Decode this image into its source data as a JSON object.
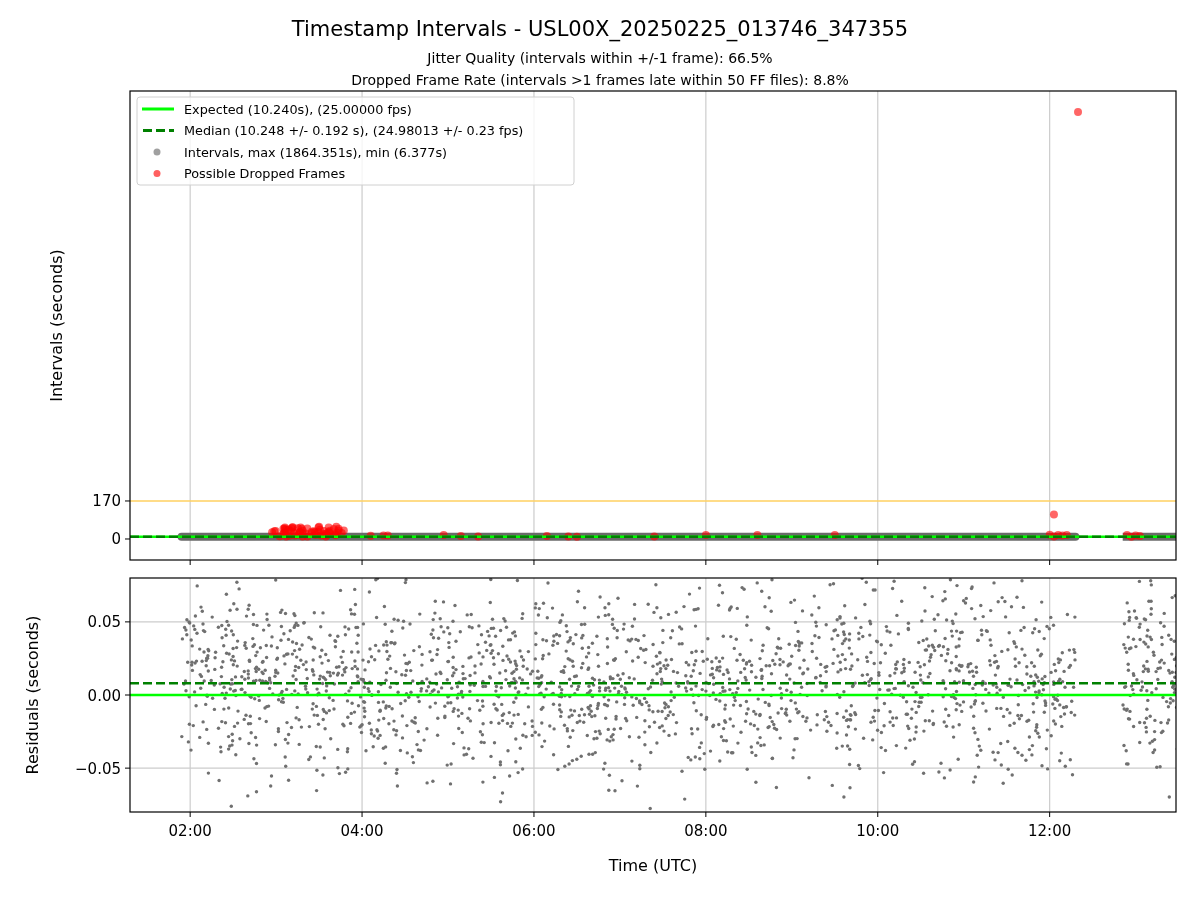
{
  "figure": {
    "title": "Timestamp Intervals - USL00X_20250225_013746_347355",
    "subtitles": [
      "Jitter Quality (intervals within +/-1 frame): 66.5%",
      "Dropped Frame Rate (intervals >1 frames late within 50 FF files): 8.8%"
    ]
  },
  "legend": [
    {
      "label": "Expected (10.240s), (25.00000 fps)",
      "kind": "line",
      "color": "#00ff00"
    },
    {
      "label": "Median (10.248 +/- 0.192 s), (24.98013 +/- 0.23 fps)",
      "kind": "dashed",
      "color": "#008000"
    },
    {
      "label": "Intervals, max (1864.351s), min (6.377s)",
      "kind": "marker",
      "color": "#a0a0a0"
    },
    {
      "label": "Possible Dropped Frames",
      "kind": "marker",
      "color": "#ff6060"
    }
  ],
  "intervals_chart": {
    "chart_data": {
      "type": "scatter",
      "ylabel": "Intervals (seconds)",
      "xlim": [
        1.3,
        13.47
      ],
      "ylim": [
        -94,
        2004
      ],
      "yticks": [
        {
          "value": 170,
          "label": "170"
        },
        {
          "value": 0,
          "label": "0"
        }
      ],
      "grid": true,
      "ref_lines": [
        {
          "axis": "y",
          "value": 170,
          "color": "#ffd060"
        },
        {
          "axis": "y",
          "value": 10.24,
          "color": "#00ff00"
        },
        {
          "axis": "y",
          "value": 10.248,
          "color": "#008000"
        }
      ]
    }
  },
  "residuals_chart": {
    "chart_data": {
      "type": "scatter",
      "xlabel": "Time (UTC)",
      "ylabel": "Residuals (seconds)",
      "xlim": [
        1.3,
        13.47
      ],
      "ylim": [
        -0.08,
        0.08
      ],
      "xticks": [
        {
          "value": 2,
          "label": "02:00"
        },
        {
          "value": 4,
          "label": "04:00"
        },
        {
          "value": 6,
          "label": "06:00"
        },
        {
          "value": 8,
          "label": "08:00"
        },
        {
          "value": 10,
          "label": "10:00"
        },
        {
          "value": 12,
          "label": "12:00"
        }
      ],
      "yticks": [
        {
          "value": 0.05,
          "label": "0.05"
        },
        {
          "value": 0,
          "label": "0.00"
        },
        {
          "value": -0.05,
          "label": "−0.05"
        }
      ],
      "grid": true,
      "ref_lines": [
        {
          "axis": "y",
          "value": 0,
          "color": "#00ff00"
        },
        {
          "axis": "y",
          "value": 0.008,
          "color": "#008000"
        }
      ]
    }
  }
}
